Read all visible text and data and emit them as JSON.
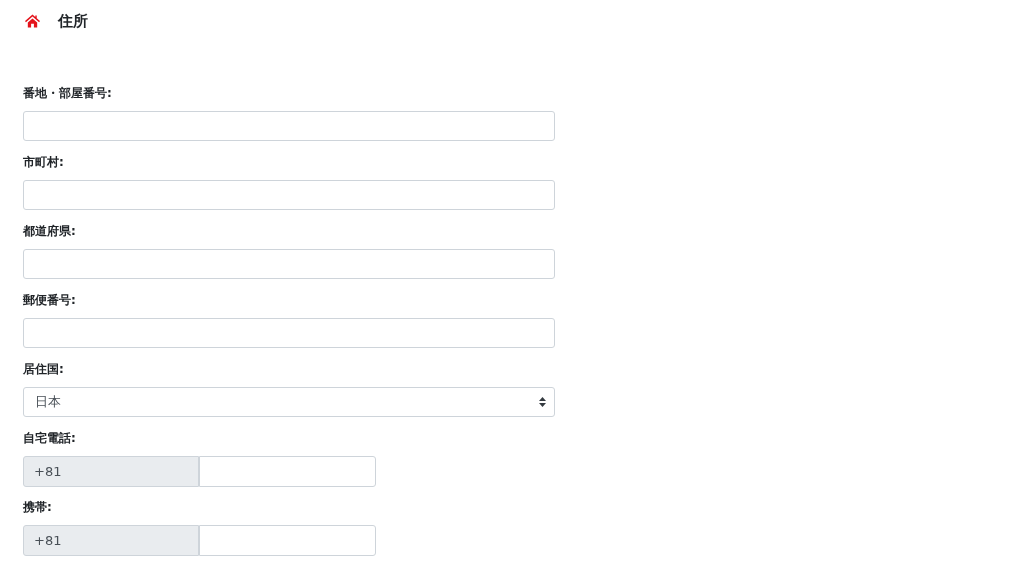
{
  "header": {
    "title": "住所"
  },
  "fields": [
    {
      "kind": "text",
      "label": "番地・部屋番号:"
    },
    {
      "kind": "text",
      "label": "市町村:"
    },
    {
      "kind": "text",
      "label": "都道府県:"
    },
    {
      "kind": "text",
      "label": "郵便番号:"
    },
    {
      "kind": "select",
      "label": "居住国:",
      "value": "日本"
    },
    {
      "kind": "phone",
      "label": "自宅電話:",
      "prefix": "+81"
    },
    {
      "kind": "phone",
      "label": "携帯:",
      "prefix": "+81"
    }
  ]
}
